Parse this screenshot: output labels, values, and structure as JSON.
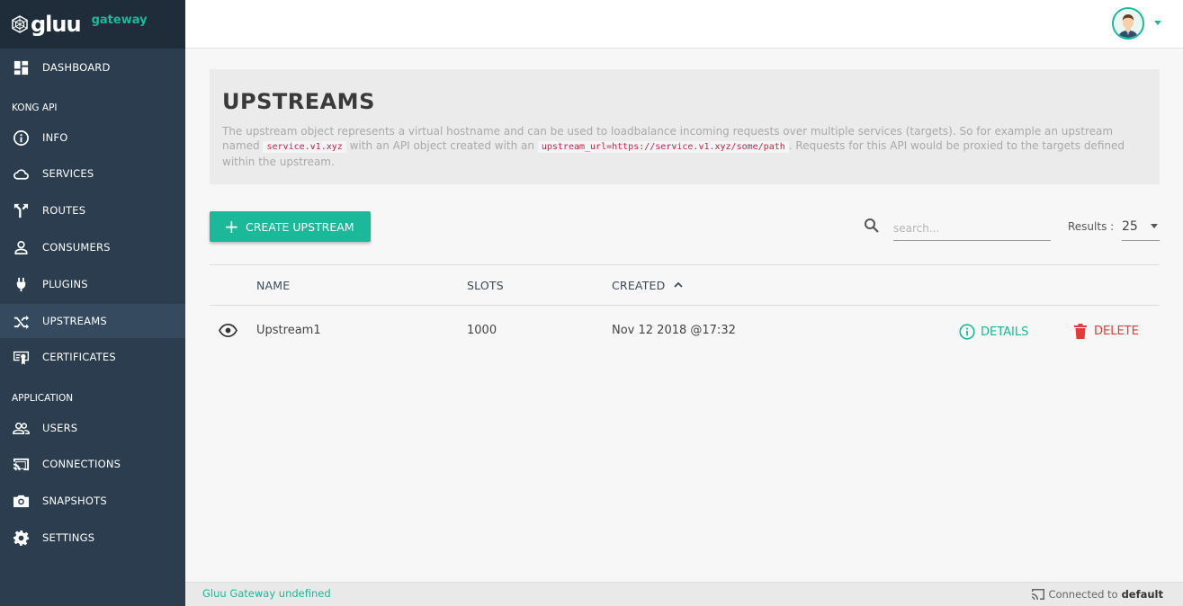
{
  "brand": {
    "name": "gluu",
    "sub": "gateway"
  },
  "sidebar": {
    "items": [
      {
        "label": "DASHBOARD",
        "icon": "dashboard-icon"
      },
      {
        "label": "INFO",
        "icon": "info-icon"
      },
      {
        "label": "SERVICES",
        "icon": "cloud-icon"
      },
      {
        "label": "ROUTES",
        "icon": "routes-icon"
      },
      {
        "label": "CONSUMERS",
        "icon": "user-icon"
      },
      {
        "label": "PLUGINS",
        "icon": "plug-icon"
      },
      {
        "label": "UPSTREAMS",
        "icon": "shuffle-icon",
        "active": true
      },
      {
        "label": "CERTIFICATES",
        "icon": "certificate-icon"
      },
      {
        "label": "USERS",
        "icon": "users-icon"
      },
      {
        "label": "CONNECTIONS",
        "icon": "cast-icon"
      },
      {
        "label": "SNAPSHOTS",
        "icon": "camera-icon"
      },
      {
        "label": "SETTINGS",
        "icon": "gear-icon"
      }
    ],
    "sections": {
      "kong_api": "KONG API",
      "application": "APPLICATION"
    }
  },
  "header": {
    "title": "UPSTREAMS",
    "desc_part1": "The upstream object represents a virtual hostname and can be used to loadbalance incoming requests over multiple services (targets). So for example an upstream named",
    "desc_code1": "service.v1.xyz",
    "desc_part2": "with an API object created with an",
    "desc_code2": "upstream_url=https://service.v1.xyz/some/path",
    "desc_part3": ". Requests for this API would be proxied to the targets defined within the upstream."
  },
  "toolbar": {
    "create_label": "CREATE UPSTREAM",
    "search_placeholder": "search...",
    "results_label": "Results :",
    "results_value": "25"
  },
  "table": {
    "columns": {
      "name": "NAME",
      "slots": "SLOTS",
      "created": "CREATED"
    },
    "rows": [
      {
        "name": "Upstream1",
        "slots": "1000",
        "created": "Nov 12 2018 @17:32",
        "details": "DETAILS",
        "delete": "DELETE"
      }
    ]
  },
  "footer": {
    "left": "Gluu Gateway undefined",
    "right_prefix": "Connected to",
    "right_value": "default"
  },
  "colors": {
    "accent": "#1cb89a",
    "danger": "#e53a3a",
    "sidebar": "#2b3d4f"
  }
}
